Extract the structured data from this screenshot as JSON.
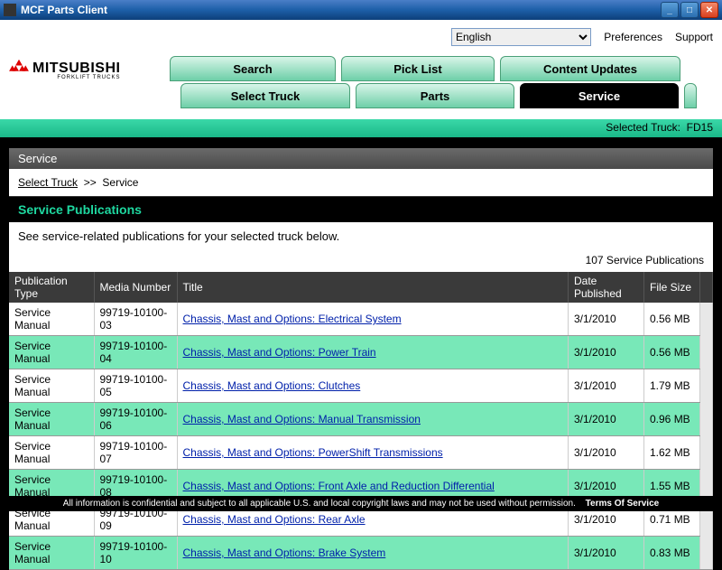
{
  "window": {
    "title": "MCF Parts Client"
  },
  "header": {
    "language": "English",
    "pref": "Preferences",
    "support": "Support",
    "logo_brand": "MITSUBISHI",
    "logo_sub": "FORKLIFT TRUCKS"
  },
  "tabs": {
    "row1": [
      "Search",
      "Pick List",
      "Content Updates"
    ],
    "row2": [
      "Select Truck",
      "Parts",
      "Service"
    ]
  },
  "selected_bar": {
    "label": "Selected Truck:",
    "value": "FD15"
  },
  "panel": {
    "title": "Service",
    "crumb_link": "Select Truck",
    "crumb_sep": ">>",
    "crumb_cur": "Service",
    "section": "Service Publications",
    "desc": "See service-related publications for your selected truck below.",
    "count": "107 Service Publications"
  },
  "table": {
    "cols": [
      "Publication Type",
      "Media Number",
      "Title",
      "Date Published",
      "File Size"
    ],
    "rows": [
      {
        "pt": "Service Manual",
        "mn": "99719-10100-03",
        "ti": "Chassis, Mast and Options: Electrical System",
        "dp": "3/1/2010",
        "fs": "0.56 MB"
      },
      {
        "pt": "Service Manual",
        "mn": "99719-10100-04",
        "ti": "Chassis, Mast and Options: Power Train",
        "dp": "3/1/2010",
        "fs": "0.56 MB"
      },
      {
        "pt": "Service Manual",
        "mn": "99719-10100-05",
        "ti": "Chassis, Mast and Options: Clutches",
        "dp": "3/1/2010",
        "fs": "1.79 MB"
      },
      {
        "pt": "Service Manual",
        "mn": "99719-10100-06",
        "ti": "Chassis, Mast and Options: Manual Transmission",
        "dp": "3/1/2010",
        "fs": "0.96 MB"
      },
      {
        "pt": "Service Manual",
        "mn": "99719-10100-07",
        "ti": "Chassis, Mast and Options: PowerShift Transmissions",
        "dp": "3/1/2010",
        "fs": "1.62 MB"
      },
      {
        "pt": "Service Manual",
        "mn": "99719-10100-08",
        "ti": "Chassis, Mast and Options: Front Axle and Reduction Differential",
        "dp": "3/1/2010",
        "fs": "1.55 MB"
      },
      {
        "pt": "Service Manual",
        "mn": "99719-10100-09",
        "ti": "Chassis, Mast and Options: Rear Axle",
        "dp": "3/1/2010",
        "fs": "0.71 MB"
      },
      {
        "pt": "Service Manual",
        "mn": "99719-10100-10",
        "ti": "Chassis, Mast and Options: Brake System",
        "dp": "3/1/2010",
        "fs": "0.83 MB"
      }
    ]
  },
  "footer": {
    "text": "All information is confidential and subject to all applicable U.S. and local copyright laws and may not be used without permission.",
    "tos": "Terms Of Service"
  }
}
